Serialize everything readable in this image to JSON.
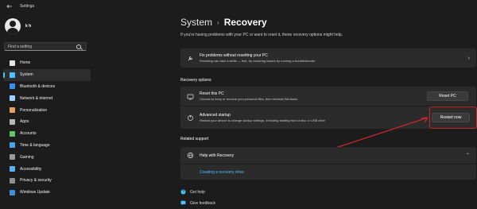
{
  "window": {
    "title": "Settings"
  },
  "user": {
    "name": "k h"
  },
  "search": {
    "placeholder": "Find a setting"
  },
  "nav": {
    "items": [
      {
        "label": "Home",
        "icon": "home-icon",
        "color": "#e5e5e5"
      },
      {
        "label": "System",
        "icon": "system-icon",
        "color": "#4cc2ff",
        "active": true
      },
      {
        "label": "Bluetooth & devices",
        "icon": "bluetooth-icon",
        "color": "#3b8eea"
      },
      {
        "label": "Network & internet",
        "icon": "network-icon",
        "color": "#9bd0ff"
      },
      {
        "label": "Personalization",
        "icon": "personalization-icon",
        "color": "#e8a15c"
      },
      {
        "label": "Apps",
        "icon": "apps-icon",
        "color": "#b8b8b8"
      },
      {
        "label": "Accounts",
        "icon": "accounts-icon",
        "color": "#5fc46a"
      },
      {
        "label": "Time & language",
        "icon": "time-language-icon",
        "color": "#4aa3e8"
      },
      {
        "label": "Gaming",
        "icon": "gaming-icon",
        "color": "#9a9a9a"
      },
      {
        "label": "Accessibility",
        "icon": "accessibility-icon",
        "color": "#5ab0f0"
      },
      {
        "label": "Privacy & security",
        "icon": "privacy-icon",
        "color": "#8e8e8e"
      },
      {
        "label": "Windows Update",
        "icon": "windows-update-icon",
        "color": "#3d8fe0"
      }
    ]
  },
  "breadcrumb": {
    "parent": "System",
    "separator": "›",
    "current": "Recovery"
  },
  "intro": "If you're having problems with your PC or want to reset it, these recovery options might help.",
  "fix_card": {
    "title": "Fix problems without resetting your PC",
    "desc": "Resetting can take a while — first, try resolving issues by running a troubleshooter"
  },
  "recovery_options": {
    "heading": "Recovery options",
    "reset": {
      "title": "Reset this PC",
      "desc": "Choose to keep or remove your personal files, then reinstall Windows",
      "button": "Reset PC"
    },
    "advanced": {
      "title": "Advanced startup",
      "desc": "Restart your device to change startup settings, including starting from a disc or USB drive",
      "button": "Restart now"
    }
  },
  "related_support": {
    "heading": "Related support",
    "help_title": "Help with Recovery",
    "link": "Creating a recovery drive"
  },
  "footer": {
    "get_help": "Get help",
    "give_feedback": "Give feedback"
  },
  "colors": {
    "accent": "#4cc2ff",
    "highlight": "#c62828",
    "arrow": "#c62828"
  }
}
